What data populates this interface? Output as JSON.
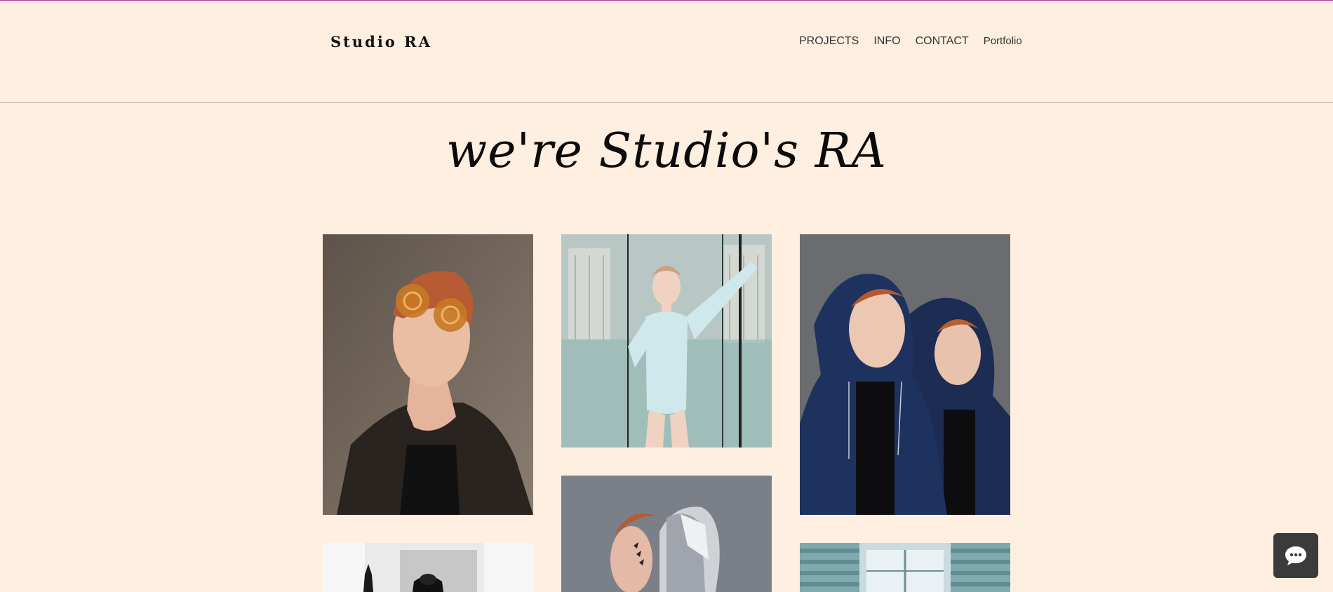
{
  "header": {
    "brand": "Studio RA",
    "nav": [
      {
        "label": "PROJECTS"
      },
      {
        "label": "INFO"
      },
      {
        "label": "CONTACT"
      },
      {
        "label": "Portfolio"
      }
    ]
  },
  "hero": {
    "title": "we're Studio's RA"
  },
  "gallery": {
    "items": [
      {
        "subject": "model with amber spiral glasses"
      },
      {
        "subject": "model in light blue bodysuit behind glass"
      },
      {
        "subject": "two models in navy hoodies"
      },
      {
        "subject": "model in silver hood"
      },
      {
        "subject": "black and white figure"
      },
      {
        "subject": "teal window shutters"
      }
    ]
  },
  "chat": {
    "icon": "chat-bubble-icon"
  },
  "colors": {
    "background": "#ffefe0",
    "top_accent": "#a8439b",
    "chat_button": "#3b3b3b"
  }
}
